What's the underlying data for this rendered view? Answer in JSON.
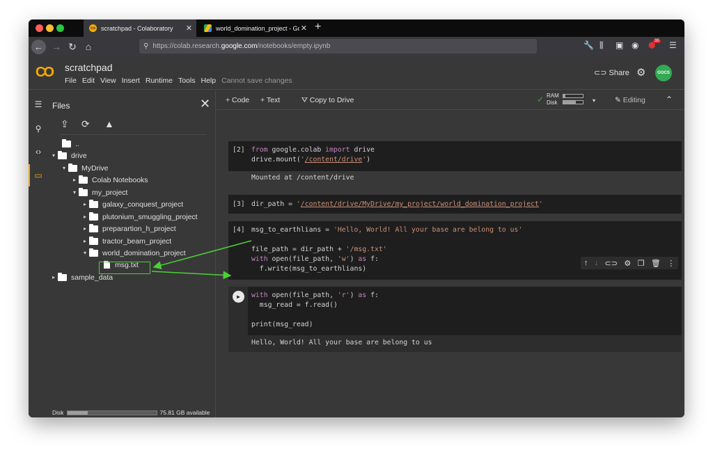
{
  "browser": {
    "tabs": [
      {
        "label": "scratchpad - Colaboratory",
        "close": "✕",
        "favicon": "co"
      },
      {
        "label": "world_domination_project - Go",
        "close": "✕",
        "favicon": "drive"
      }
    ],
    "new_tab": "+",
    "url_prefix": "https://colab.research.",
    "url_domain": "google.com",
    "url_suffix": "/notebooks/empty.ipynb",
    "extension_badge": "35"
  },
  "colab": {
    "logo": "CO",
    "notebook_title": "scratchpad",
    "menu": [
      "File",
      "Edit",
      "View",
      "Insert",
      "Runtime",
      "Tools",
      "Help"
    ],
    "menu_note": "Cannot save changes",
    "share_label": "Share",
    "avatar_text": "GOCS"
  },
  "files_panel": {
    "title": "Files",
    "close": "✕",
    "tree": [
      {
        "label": "..",
        "type": "up",
        "depth": 0,
        "caret": ""
      },
      {
        "label": "drive",
        "type": "folder",
        "depth": 0,
        "caret": "▾"
      },
      {
        "label": "MyDrive",
        "type": "folder",
        "depth": 1,
        "caret": "▾"
      },
      {
        "label": "Colab Notebooks",
        "type": "folder",
        "depth": 2,
        "caret": "▸"
      },
      {
        "label": "my_project",
        "type": "folder",
        "depth": 2,
        "caret": "▾"
      },
      {
        "label": "galaxy_conquest_project",
        "type": "folder",
        "depth": 3,
        "caret": "▸"
      },
      {
        "label": "plutonium_smuggling_project",
        "type": "folder",
        "depth": 3,
        "caret": "▸"
      },
      {
        "label": "preparartion_h_project",
        "type": "folder",
        "depth": 3,
        "caret": "▸"
      },
      {
        "label": "tractor_beam_project",
        "type": "folder",
        "depth": 3,
        "caret": "▸"
      },
      {
        "label": "world_domination_project",
        "type": "folder",
        "depth": 3,
        "caret": "▾"
      },
      {
        "label": "msg.txt",
        "type": "file",
        "depth": 4,
        "caret": ""
      },
      {
        "label": "sample_data",
        "type": "folder",
        "depth": 0,
        "caret": "▸"
      }
    ],
    "disk_label": "Disk",
    "disk_available": "75.81 GB available",
    "disk_used_fraction": 0.23
  },
  "toolbar": {
    "add_code": "+ Code",
    "add_text": "+ Text",
    "copy_to_drive": "Copy to Drive",
    "ram_label": "RAM",
    "disk_label": "Disk",
    "ram_fraction": 0.1,
    "disk_fraction": 0.65,
    "editing_label": "Editing"
  },
  "cells": [
    {
      "prompt": "[2]",
      "output": "Mounted at /content/drive"
    },
    {
      "prompt": "[3]"
    },
    {
      "prompt": "[4]"
    },
    {
      "prompt": "",
      "output": "Hello, World! All your base are belong to us"
    }
  ]
}
